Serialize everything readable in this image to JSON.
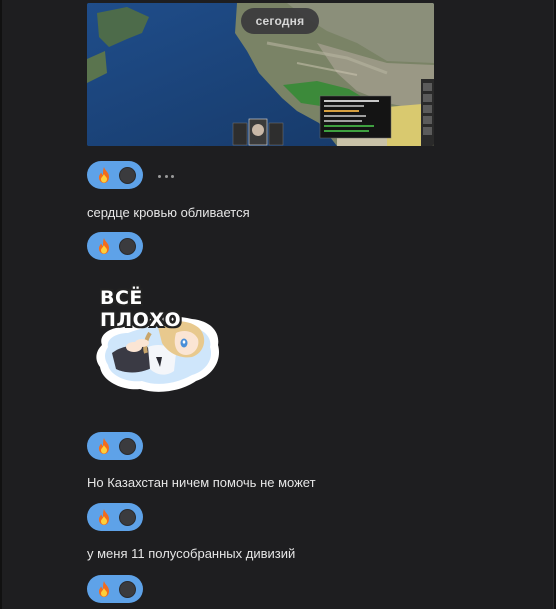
{
  "chat": {
    "date_separator": "сегодня",
    "messages": [
      {
        "type": "image",
        "reaction": {
          "emoji": "fire-emoji",
          "count_avatar": true
        }
      },
      {
        "type": "text",
        "text": "сердце кровью обливается",
        "reaction": {
          "emoji": "fire-emoji"
        }
      },
      {
        "type": "sticker",
        "caption": "ВСЁ ПЛОХО",
        "reaction": {
          "emoji": "fire-emoji"
        }
      },
      {
        "type": "text",
        "text": "Но Казахстан ничем помочь не может",
        "reaction": {
          "emoji": "fire-emoji"
        }
      },
      {
        "type": "text",
        "text": "у меня 11 полусобранных дивизий",
        "reaction": {
          "emoji": "fire-emoji"
        }
      }
    ]
  },
  "colors": {
    "background": "#1e1e20",
    "reaction_bg": "#5ea2e8",
    "text": "#e6e6e6"
  }
}
